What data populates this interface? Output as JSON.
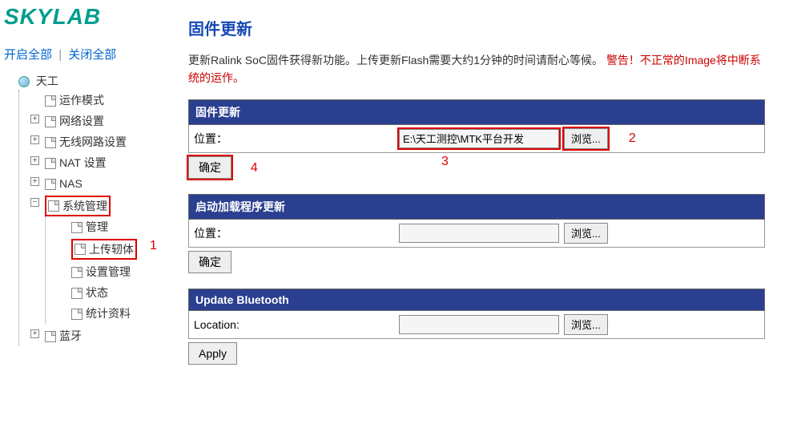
{
  "logo": "SKYLAB",
  "links": {
    "open_all": "开启全部",
    "close_all": "关闭全部"
  },
  "tree": {
    "tiangong": "天工",
    "op_mode": "运作模式",
    "network": "网络设置",
    "wireless": "无线网路设置",
    "nat": "NAT 设置",
    "nas": "NAS",
    "sysmgmt": "系统管理",
    "mgmt": "管理",
    "upload_fw": "上传轫体",
    "settings_mgmt": "设置管理",
    "status": "状态",
    "stats": "统计资料",
    "bluetooth": "蓝牙"
  },
  "annotations": {
    "a1": "1",
    "a2": "2",
    "a3": "3",
    "a4": "4"
  },
  "page": {
    "title": "固件更新",
    "desc_part1": "更新Ralink SoC固件获得新功能。上传更新Flash需要大约1分钟的时间请耐心等候。",
    "desc_warn": "警告！不正常的Image将中断系统的运作。"
  },
  "panel1": {
    "header": "固件更新",
    "label": "位置：",
    "value": "E:\\天工测控\\MTK平台开发",
    "browse": "浏览...",
    "submit": "确定"
  },
  "panel2": {
    "header": "启动加载程序更新",
    "label": "位置：",
    "value": "",
    "browse": "浏览...",
    "submit": "确定"
  },
  "panel3": {
    "header": "Update Bluetooth",
    "label": "Location:",
    "value": "",
    "browse": "浏览...",
    "submit": "Apply"
  }
}
